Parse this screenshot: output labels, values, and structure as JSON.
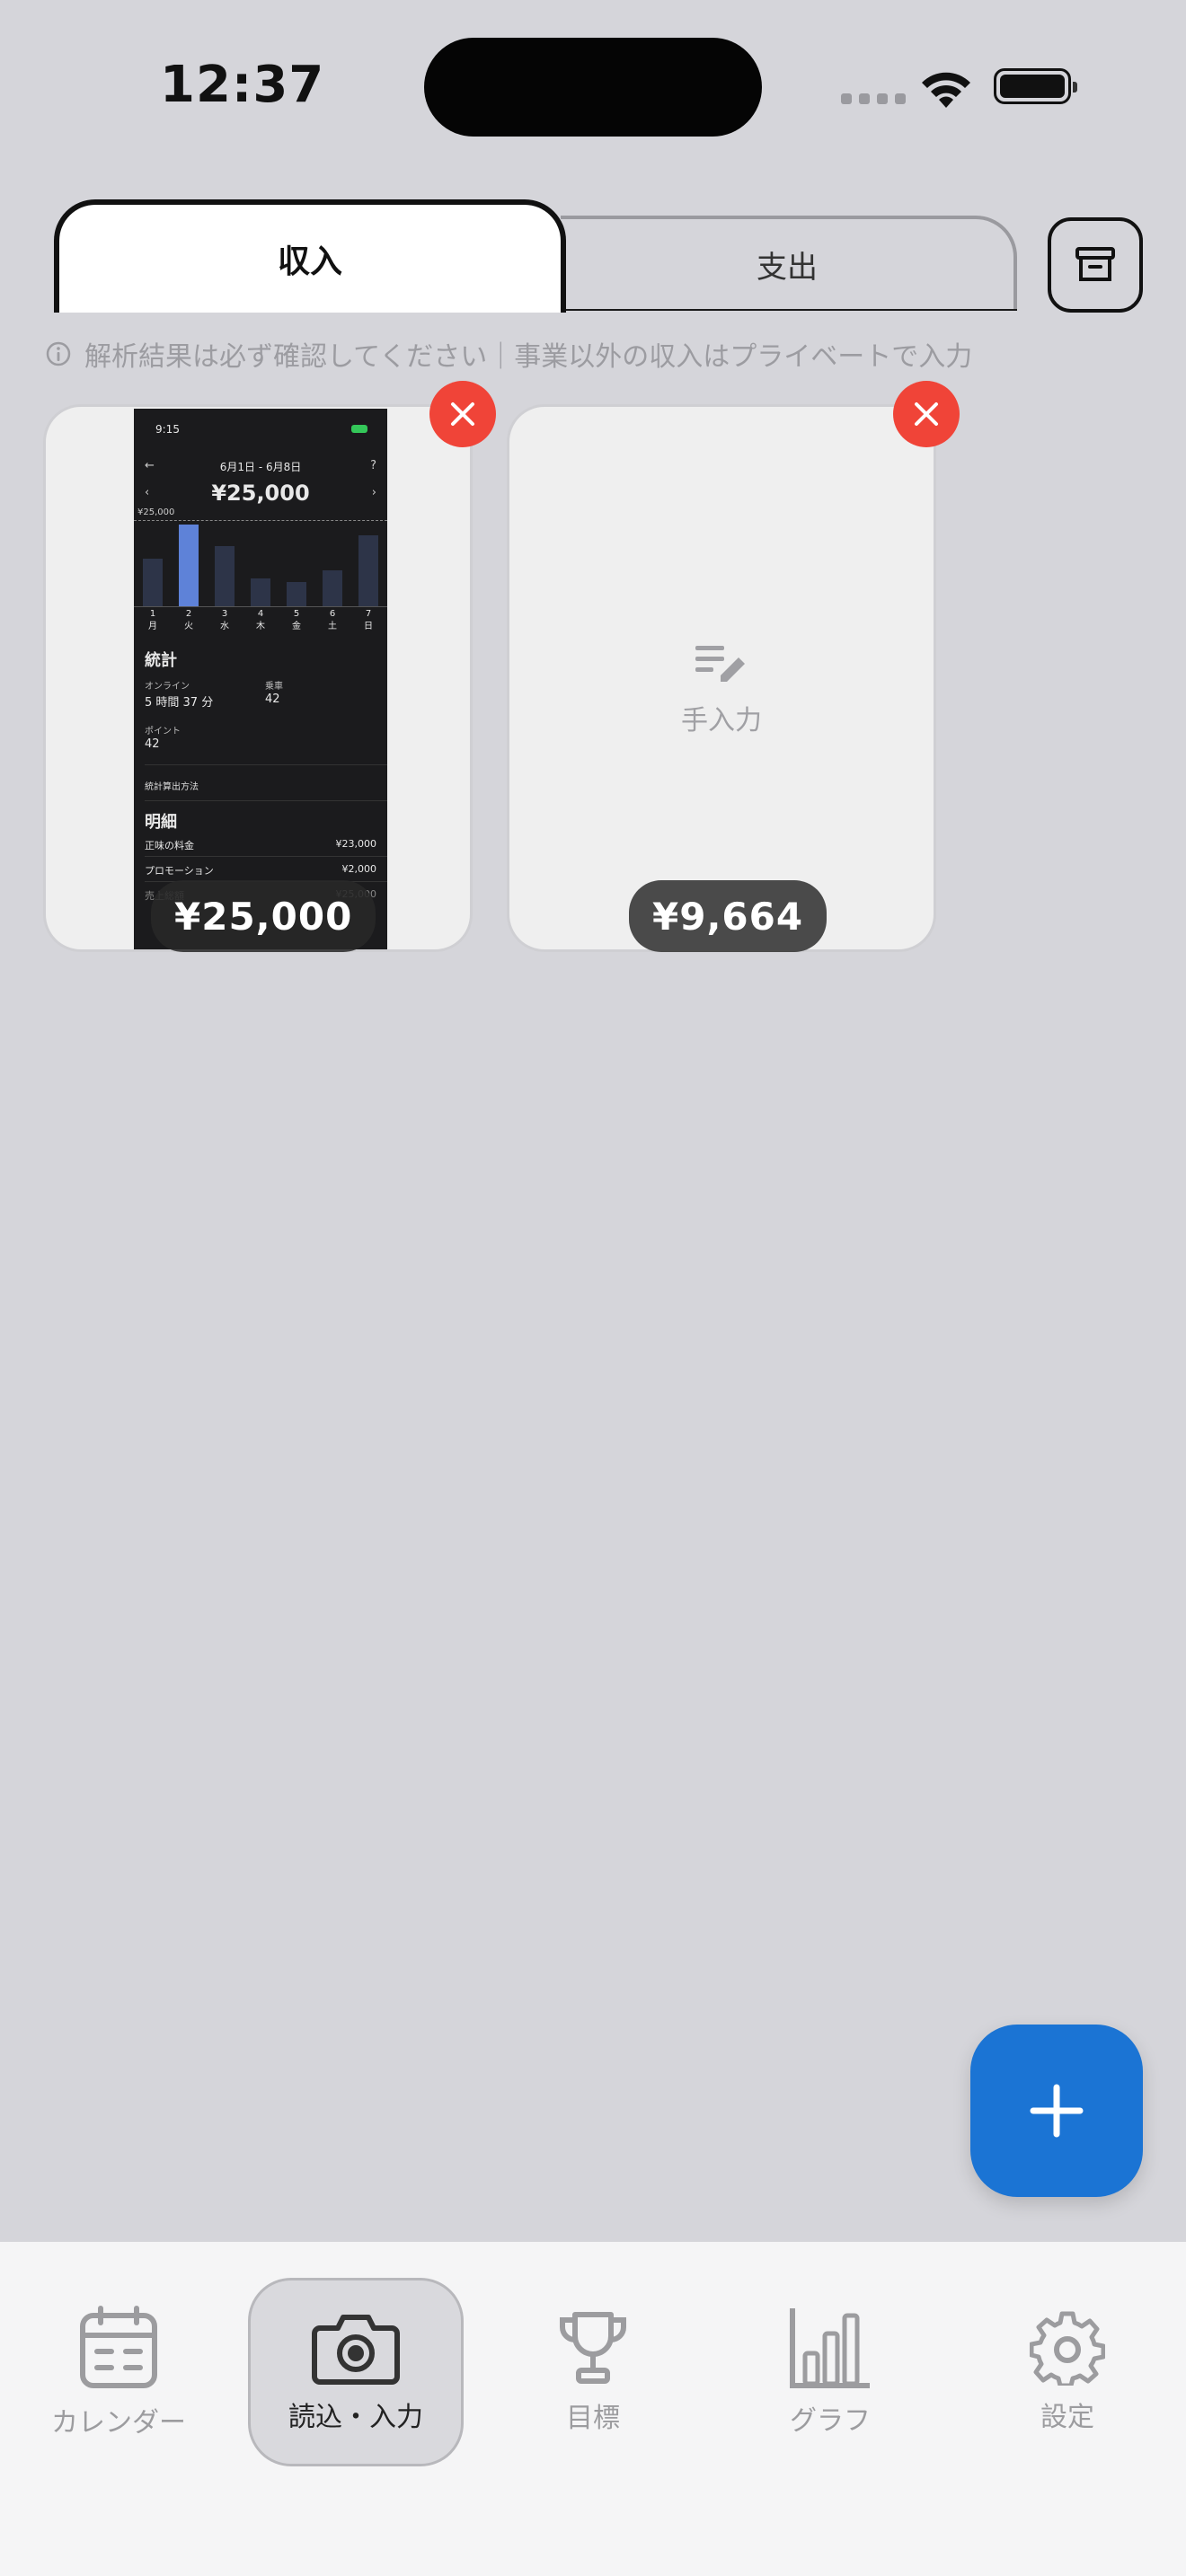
{
  "status_bar": {
    "time": "12:37"
  },
  "tabs": [
    {
      "label": "収入",
      "selected": true
    },
    {
      "label": "支出",
      "selected": false
    }
  ],
  "note": "解析結果は必ず確認してください｜事業以外の収入はプライベートで入力",
  "cards": [
    {
      "type": "screenshot",
      "amount": "¥25,000",
      "thumbnail": {
        "time": "9:15",
        "battery": "73+",
        "range": "6月1日 - 6月8日",
        "total": "¥25,000",
        "ref_line": "¥25,000",
        "bar_values": [
          0.55,
          0.95,
          0.7,
          0.32,
          0.28,
          0.42,
          0.82
        ],
        "highlight_index": 1,
        "days": [
          {
            "num": "1",
            "dow": "月"
          },
          {
            "num": "2",
            "dow": "火"
          },
          {
            "num": "3",
            "dow": "水"
          },
          {
            "num": "4",
            "dow": "木"
          },
          {
            "num": "5",
            "dow": "金"
          },
          {
            "num": "6",
            "dow": "土"
          },
          {
            "num": "7",
            "dow": "日"
          }
        ],
        "stats_heading": "統計",
        "online_label": "オンライン",
        "online_value": "5 時間 37 分",
        "rides_label": "乗車",
        "rides_value": "42",
        "points_label": "ポイント",
        "points_value": "42",
        "calc_label": "統計算出方法",
        "detail_heading": "明細",
        "items": [
          {
            "label": "正味の料金",
            "value": "¥23,000"
          },
          {
            "label": "プロモーション",
            "value": "¥2,000"
          },
          {
            "label": "売上総額",
            "value": "¥25,000"
          }
        ]
      }
    },
    {
      "type": "manual",
      "amount": "¥9,664",
      "label": "手入力"
    }
  ],
  "nav": [
    {
      "label": "カレンダー",
      "icon": "calendar-icon",
      "active": false
    },
    {
      "label": "読込・入力",
      "icon": "camera-icon",
      "active": true
    },
    {
      "label": "目標",
      "icon": "trophy-icon",
      "active": false
    },
    {
      "label": "グラフ",
      "icon": "bar-chart-icon",
      "active": false
    },
    {
      "label": "設定",
      "icon": "gear-icon",
      "active": false
    }
  ],
  "colors": {
    "background": "#d5d5da",
    "accent": "#1b74d4",
    "delete": "#f04438",
    "chart_highlight": "#5e82d8"
  }
}
